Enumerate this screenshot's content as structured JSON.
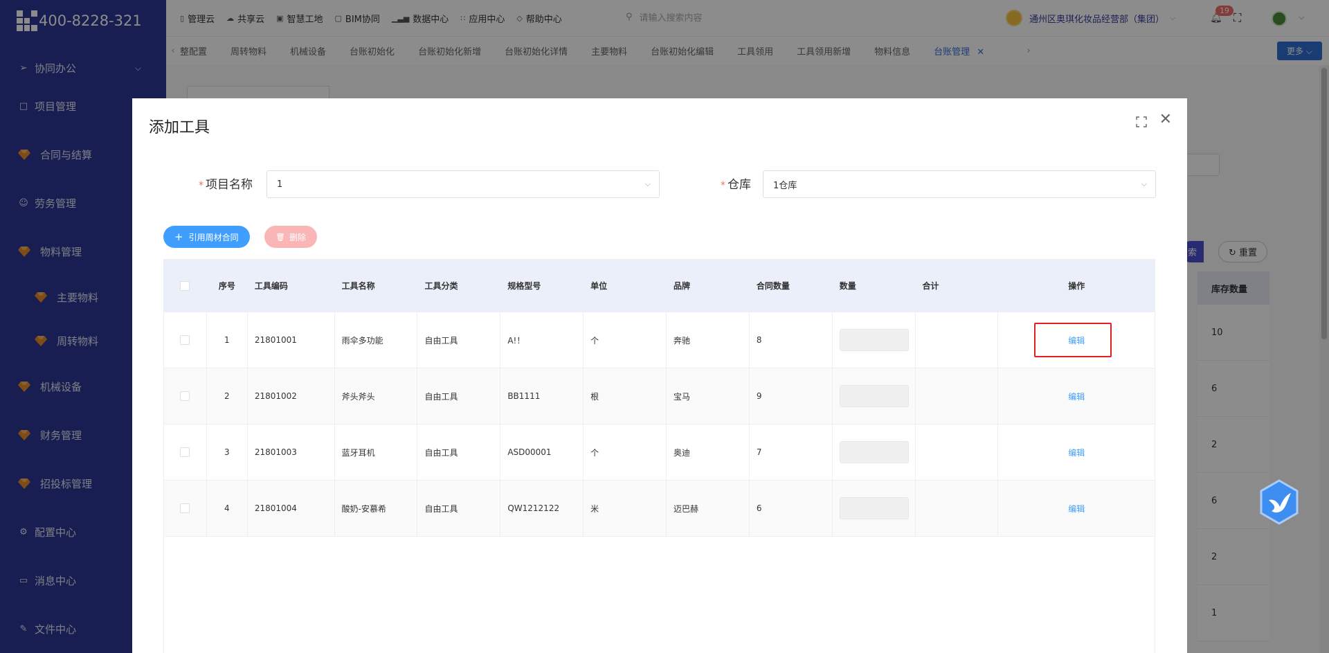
{
  "app": {
    "phone": "400-8228-321"
  },
  "sidebar": {
    "items": [
      {
        "label": "协同办公",
        "icon": "send-icon",
        "expandable": true
      },
      {
        "label": "项目管理",
        "icon": "book-icon"
      },
      {
        "label": "合同与结算",
        "icon": "gem-icon"
      },
      {
        "label": "劳务管理",
        "icon": "user-icon"
      },
      {
        "label": "物料管理",
        "icon": "gem-icon"
      },
      {
        "label": "主要物料",
        "icon": "gem-icon",
        "sub": true
      },
      {
        "label": "周转物料",
        "icon": "gem-icon",
        "sub": true
      },
      {
        "label": "机械设备",
        "icon": "gem-icon"
      },
      {
        "label": "财务管理",
        "icon": "gem-icon"
      },
      {
        "label": "招投标管理",
        "icon": "gem-icon"
      },
      {
        "label": "配置中心",
        "icon": "gear-icon"
      },
      {
        "label": "消息中心",
        "icon": "message-icon"
      },
      {
        "label": "文件中心",
        "icon": "edit-icon"
      }
    ]
  },
  "topnav": {
    "items": [
      {
        "label": "管理云",
        "icon": "doc-icon"
      },
      {
        "label": "共享云",
        "icon": "cloud-icon"
      },
      {
        "label": "智慧工地",
        "icon": "monitor-icon"
      },
      {
        "label": "BIM协同",
        "icon": "cube-icon"
      },
      {
        "label": "数据中心",
        "icon": "bar-chart-icon"
      },
      {
        "label": "应用中心",
        "icon": "grid-icon"
      },
      {
        "label": "帮助中心",
        "icon": "help-icon"
      }
    ],
    "search_placeholder": "请输入搜索内容",
    "company": "通州区奥琪化妆品经营部（集团）",
    "notification_count": "19"
  },
  "tabs": {
    "items": [
      "整配置",
      "周转物料",
      "机械设备",
      "台账初始化",
      "台账初始化新增",
      "台账初始化详情",
      "主要物料",
      "台账初始化编辑",
      "工具领用",
      "工具领用新增",
      "物料信息"
    ],
    "active": "台账管理",
    "more": "更多"
  },
  "background": {
    "search_btn": "索",
    "reset_btn": "重置",
    "stock_header": "库存数量",
    "stock_values": [
      "10",
      "6",
      "2",
      "6",
      "2",
      "1"
    ]
  },
  "dialog": {
    "title": "添加工具",
    "project_label": "项目名称",
    "project_value": "1",
    "warehouse_label": "仓库",
    "warehouse_value": "1仓库",
    "cite_button": "引用周材合同",
    "delete_button": "删除",
    "table": {
      "headers": [
        "序号",
        "工具编码",
        "工具名称",
        "工具分类",
        "规格型号",
        "单位",
        "品牌",
        "合同数量",
        "数量",
        "合计",
        "操作"
      ],
      "rows": [
        {
          "idx": "1",
          "code": "21801001",
          "name": "雨伞多功能",
          "category": "自由工具",
          "spec": "A!！",
          "unit": "个",
          "brand": "奔驰",
          "contract_qty": "8",
          "op": "编辑"
        },
        {
          "idx": "2",
          "code": "21801002",
          "name": "斧头斧头",
          "category": "自由工具",
          "spec": "BB1111",
          "unit": "根",
          "brand": "宝马",
          "contract_qty": "9",
          "op": "编辑"
        },
        {
          "idx": "3",
          "code": "21801003",
          "name": "蓝牙耳机",
          "category": "自由工具",
          "spec": "ASD00001",
          "unit": "个",
          "brand": "奥迪",
          "contract_qty": "7",
          "op": "编辑"
        },
        {
          "idx": "4",
          "code": "21801004",
          "name": "酸奶-安慕希",
          "category": "自由工具",
          "spec": "QW1212122",
          "unit": "米",
          "brand": "迈巴赫",
          "contract_qty": "6",
          "op": "编辑"
        }
      ]
    }
  },
  "colors": {
    "sidebar": "#2d3796",
    "primary": "#409eff",
    "danger_light": "#fab6b6",
    "highlight_box": "#e02020"
  }
}
